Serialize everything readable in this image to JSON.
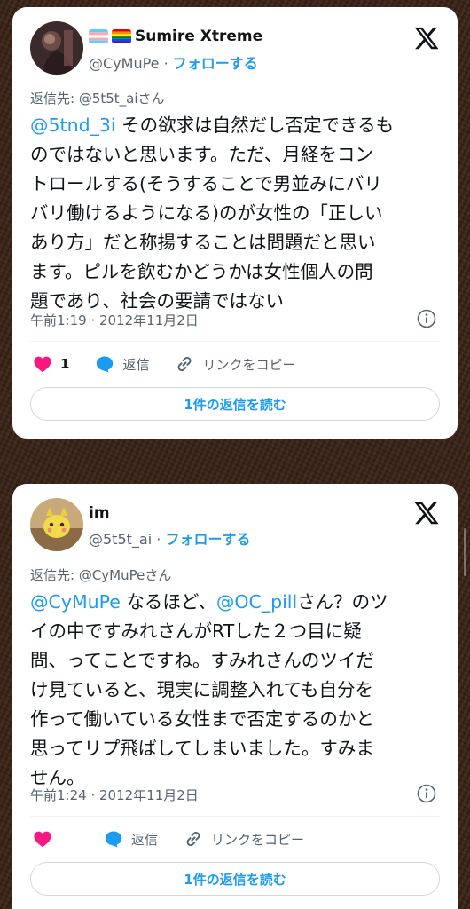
{
  "tweets": [
    {
      "display_name": "Sumire Xtreme",
      "handle": "@CyMuPe",
      "separator": "·",
      "follow_label": "フォローする",
      "reply_to": "返信先: @5t5t_aiさん",
      "mention": "@5tnd_3i",
      "lines": [
        " その欲求は自然だし否定できるも",
        "のではないと思います。ただ、月経をコン",
        "トロールする(そうすることで男並みにバリ",
        "バリ働けるようになる)のが女性の「正しい",
        "あり方」だと称揚することは問題だと思い",
        "ます。ピルを飲むかどうかは女性個人の問",
        "題であり、社会の要請ではない"
      ],
      "timestamp": "午前1:19 · 2012年11月2日",
      "like_count": "1",
      "reply_label": "返信",
      "copy_link_label": "リンクをコピー",
      "read_replies_label": "1件の返信を読む"
    },
    {
      "display_name": "im",
      "handle": "@5t5t_ai",
      "separator": "·",
      "follow_label": "フォローする",
      "reply_to": "返信先: @CyMuPeさん",
      "mention1": "@CyMuPe",
      "mid1": " なるほど、",
      "mention2": "@OC_pill",
      "mid2": "さん？のツ",
      "lines": [
        "イの中ですみれさんがRTした２つ目に疑",
        "問、ってことですね。すみれさんのツイだ",
        "け見ていると、現実に調整入れても自分を",
        "作って働いている女性まで否定するのかと",
        "思ってリプ飛ばしてしまいました。すみま",
        "せん。"
      ],
      "timestamp": "午前1:24 · 2012年11月2日",
      "reply_label": "返信",
      "copy_link_label": "リンクをコピー",
      "read_replies_label": "1件の返信を読む"
    }
  ],
  "colors": {
    "accent": "#1d9bf0",
    "like": "#f91880",
    "text": "#0f1419",
    "muted": "#536471",
    "background": "#3a2317"
  },
  "icons": [
    "trans-flag-icon",
    "rainbow-flag-icon",
    "x-logo-icon",
    "info-icon",
    "heart-icon",
    "reply-bubble-icon",
    "link-icon"
  ]
}
